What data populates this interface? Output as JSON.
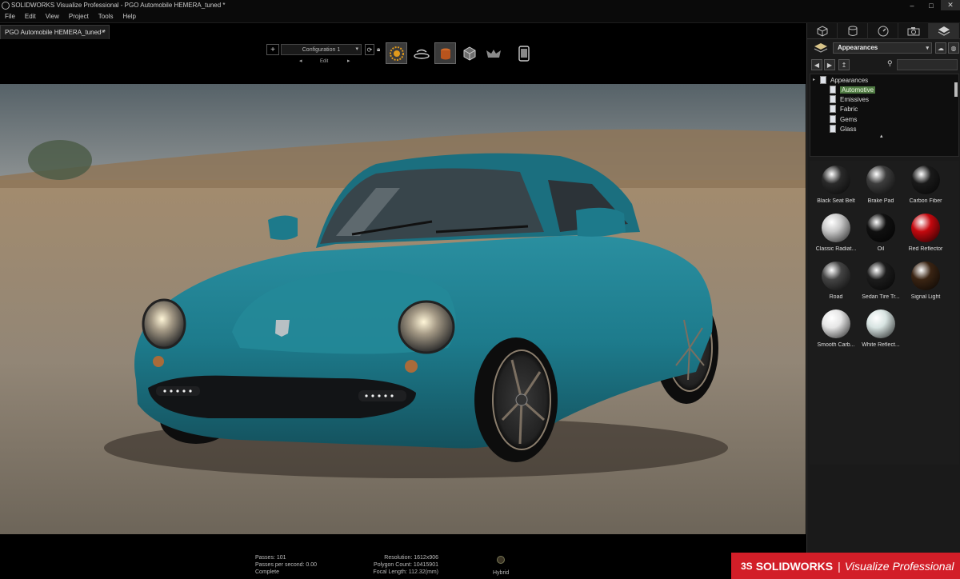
{
  "window": {
    "title": "SOLIDWORKS Visualize Professional - PGO Automobile HEMERA_tuned *",
    "controls": [
      "–",
      "□",
      "✕"
    ]
  },
  "menu": [
    "File",
    "Edit",
    "View",
    "Project",
    "Tools",
    "Help"
  ],
  "doc_tab": {
    "label": "PGO Automobile HEMERA_tuned *",
    "close": "×"
  },
  "toolbar": {
    "add": "+",
    "configuration": "Configuration 1",
    "edit_label": "Edit",
    "prev": "◂",
    "next": "▸"
  },
  "status": {
    "passes": "Passes: 101",
    "passes_per_second": "Passes per second: 0.00",
    "state": "Complete",
    "resolution": "Resolution: 1612x906",
    "polygon_count": "Polygon Count: 10415901",
    "focal_length": "Focal Length: 112.32(mm)",
    "render_mode": "Hybrid"
  },
  "panel": {
    "tabs": [
      "model-icon",
      "cylinder-icon",
      "gauge-icon",
      "camera-icon",
      "layers-icon"
    ],
    "library": "Appearances",
    "tree": {
      "root": "Appearances",
      "items": [
        "Automotive",
        "Emissives",
        "Fabric",
        "Gems",
        "Glass"
      ],
      "selected": "Automotive"
    },
    "swatches": [
      {
        "label": "Black Seat Belt",
        "color": "#2a2a2a"
      },
      {
        "label": "Brake Pad",
        "color": "#3d3d3d"
      },
      {
        "label": "Carbon Fiber",
        "color": "#1a1a1a"
      },
      {
        "label": "Classic Radiat...",
        "color": "#c8c8c8"
      },
      {
        "label": "Oil",
        "color": "#101010"
      },
      {
        "label": "Red Reflector",
        "color": "#c4080e"
      },
      {
        "label": "Road",
        "color": "#444444"
      },
      {
        "label": "Sedan Tire Tr...",
        "color": "#1c1c1c"
      },
      {
        "label": "Signal Light",
        "color": "#3a2413"
      },
      {
        "label": "Smooth Carb...",
        "color": "#e6e6e6"
      },
      {
        "label": "White Reflect...",
        "color": "#d8e4e2"
      }
    ]
  },
  "brand": {
    "ds": "3S",
    "name": "SOLIDWORKS",
    "sep": "|",
    "product": "Visualize Professional",
    "color": "#d21e28"
  },
  "colors": {
    "car_body": "#1f7d8f",
    "selection": "#4f7a43"
  }
}
